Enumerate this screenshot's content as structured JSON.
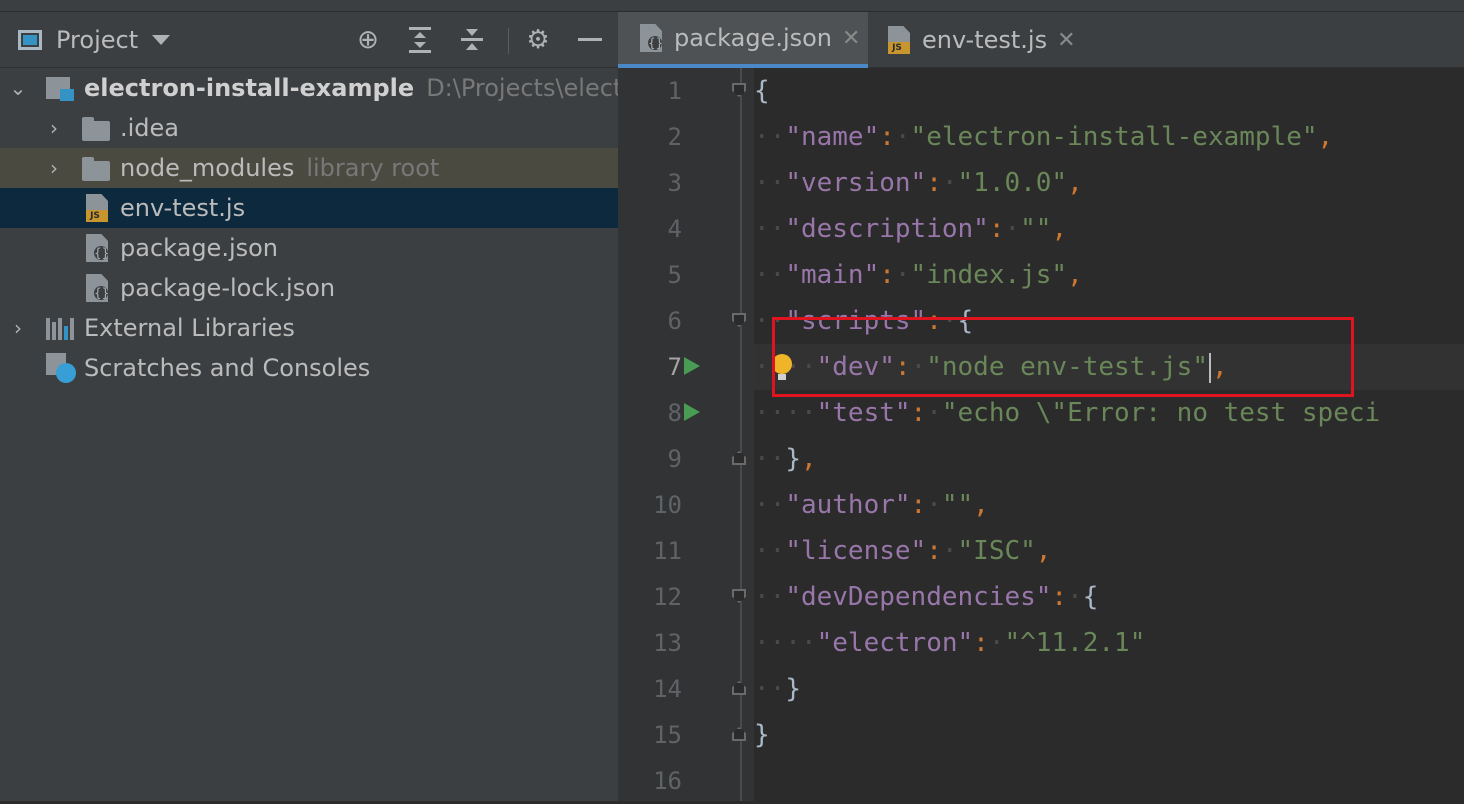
{
  "sidebar": {
    "title": "Project",
    "toolbar_icons": [
      "locate-icon",
      "expand-all-icon",
      "collapse-all-icon",
      "settings-icon",
      "hide-icon"
    ],
    "tree": {
      "root": {
        "name": "electron-install-example",
        "path": "D:\\Projects\\electron"
      },
      "idea": {
        "name": ".idea"
      },
      "node_modules": {
        "name": "node_modules",
        "badge": "library root"
      },
      "env_test": {
        "name": "env-test.js"
      },
      "package_json": {
        "name": "package.json"
      },
      "package_lock": {
        "name": "package-lock.json"
      },
      "external_libraries": {
        "name": "External Libraries"
      },
      "scratches": {
        "name": "Scratches and Consoles"
      }
    }
  },
  "editor": {
    "tabs": [
      {
        "label": "package.json",
        "active": true
      },
      {
        "label": "env-test.js",
        "active": false
      }
    ],
    "line_numbers": [
      "1",
      "2",
      "3",
      "4",
      "5",
      "6",
      "7",
      "8",
      "9",
      "10",
      "11",
      "12",
      "13",
      "14",
      "15",
      "16"
    ],
    "current_line": 7,
    "code": {
      "l2_key": "\"name\"",
      "l2_val": "\"electron-install-example\"",
      "l3_key": "\"version\"",
      "l3_val": "\"1.0.0\"",
      "l4_key": "\"description\"",
      "l4_val": "\"\"",
      "l5_key": "\"main\"",
      "l5_val": "\"index.js\"",
      "l6_key": "\"scripts\"",
      "l7_key": "\"dev\"",
      "l7_val": "\"node env-test.js\"",
      "l8_key": "\"test\"",
      "l8_val": "\"echo \\\"Error: no test speci",
      "l10_key": "\"author\"",
      "l10_val": "\"\"",
      "l11_key": "\"license\"",
      "l11_val": "\"ISC\"",
      "l12_key": "\"devDependencies\"",
      "l13_key": "\"electron\"",
      "l13_val": "\"^11.2.1\""
    }
  },
  "colors": {
    "key": "#9876aa",
    "string": "#6a8759",
    "punctuation": "#cc7832",
    "selection": "#0d293e",
    "annotation_box": "#e0141e"
  }
}
